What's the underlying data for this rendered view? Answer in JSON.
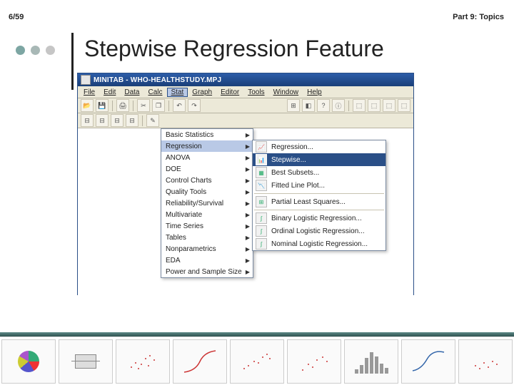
{
  "page_number": "6/59",
  "part_label": "Part 9: Topics",
  "slide_title": "Stepwise Regression Feature",
  "app": {
    "title": "MINITAB - WHO-HEALTHSTUDY.MPJ",
    "menubar": [
      "File",
      "Edit",
      "Data",
      "Calc",
      "Stat",
      "Graph",
      "Editor",
      "Tools",
      "Window",
      "Help"
    ],
    "open_menu_index": 4,
    "stat_menu": [
      "Basic Statistics",
      "Regression",
      "ANOVA",
      "DOE",
      "Control Charts",
      "Quality Tools",
      "Reliability/Survival",
      "Multivariate",
      "Time Series",
      "Tables",
      "Nonparametrics",
      "EDA",
      "Power and Sample Size"
    ],
    "stat_highlight_index": 1,
    "regression_submenu": [
      "Regression...",
      "Stepwise...",
      "Best Subsets...",
      "Fitted Line Plot...",
      "Partial Least Squares...",
      "Binary Logistic Regression...",
      "Ordinal Logistic Regression...",
      "Nominal Logistic Regression..."
    ],
    "submenu_highlight_index": 1,
    "toolbar1_icons": [
      "open",
      "save",
      "|",
      "print",
      "|",
      "cut",
      "copy",
      "|",
      "undo",
      "redo"
    ],
    "toolbar2_icons": [
      "t1",
      "t2",
      "t3",
      "t4",
      "|",
      "brush"
    ],
    "toolbar_right_icons": [
      "a",
      "b",
      "c",
      "d",
      "|",
      "e",
      "f",
      "g",
      "h"
    ]
  },
  "thumbnails": [
    "pie",
    "box",
    "scatter",
    "curve",
    "scatter",
    "scatter",
    "hist",
    "curve",
    "scatter"
  ]
}
